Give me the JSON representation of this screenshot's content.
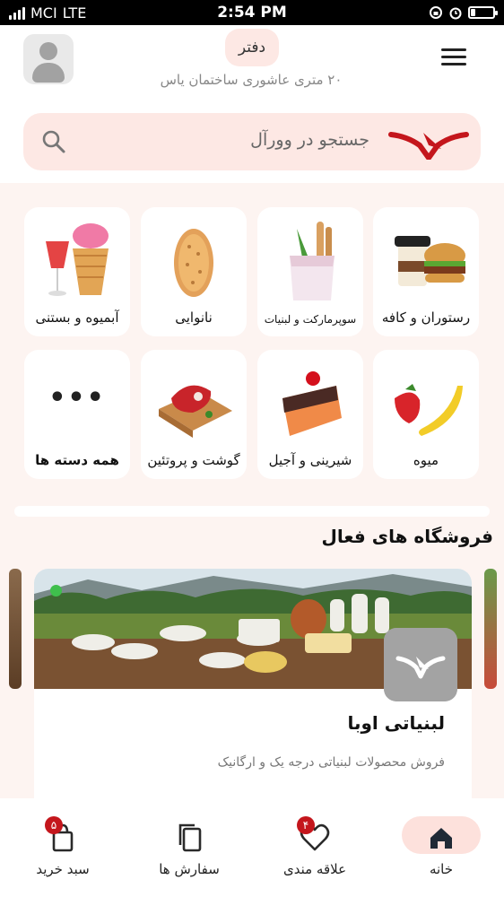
{
  "status_bar": {
    "carrier": "MCI",
    "network": "LTE",
    "time": "2:54 PM",
    "battery_level": 0.2
  },
  "header": {
    "location_label": "دفتر",
    "address": "۲۰ متری عاشوری ساختمان یاس"
  },
  "search": {
    "placeholder": "جستجو در وورآل"
  },
  "categories": [
    {
      "label": "رستوران و کافه",
      "icon": "burger-coffee-icon"
    },
    {
      "label": "سوپرمارکت و لبنیات",
      "icon": "grocery-bag-icon"
    },
    {
      "label": "نانوایی",
      "icon": "bread-icon"
    },
    {
      "label": "آبمیوه و بستنی",
      "icon": "ice-cream-juice-icon"
    },
    {
      "label": "میوه",
      "icon": "fruit-icon"
    },
    {
      "label": "شیرینی و آجیل",
      "icon": "cake-icon"
    },
    {
      "label": "گوشت و پروتئین",
      "icon": "meat-icon"
    },
    {
      "label": "همه دسته ها",
      "dots": "•••"
    }
  ],
  "active_stores": {
    "title": "فروشگاه های فعال",
    "stores": [
      {
        "name": "لبنیاتی اوبا",
        "description": "فروش محصولات لبنیاتی درجه یک و ارگانیک",
        "open": true
      }
    ]
  },
  "bottom_nav": {
    "items": [
      {
        "label": "خانه",
        "icon": "home-icon",
        "active": true
      },
      {
        "label": "علاقه مندی",
        "icon": "heart-icon",
        "badge": "۴"
      },
      {
        "label": "سفارش ها",
        "icon": "orders-icon"
      },
      {
        "label": "سبد خرید",
        "icon": "cart-bag-icon",
        "badge": "۵"
      }
    ]
  },
  "colors": {
    "accent": "#c4161c",
    "pill": "#fde8e4",
    "background": "#fdf4f1"
  }
}
